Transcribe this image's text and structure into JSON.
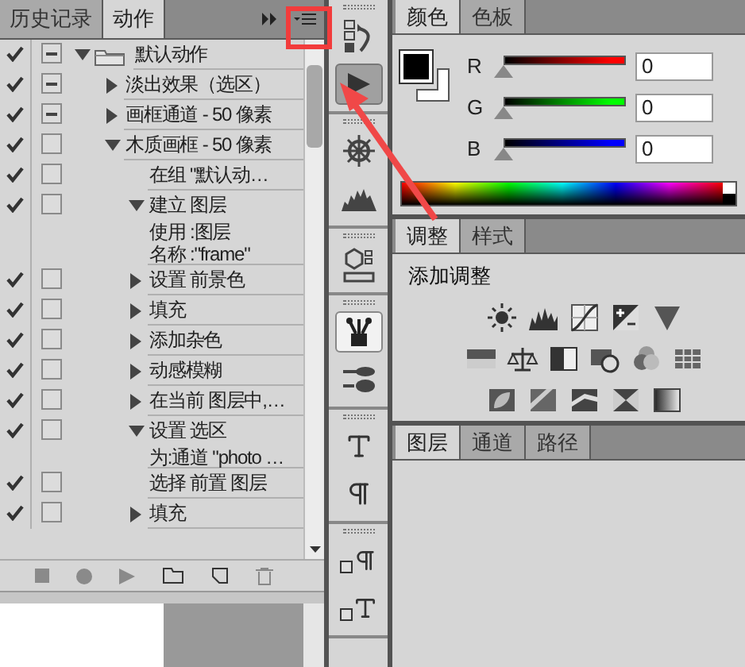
{
  "actions_panel": {
    "tabs": [
      {
        "label": "历史记录",
        "selected": false
      },
      {
        "label": "动作",
        "selected": true
      }
    ],
    "actions": [
      {
        "label": "默认动作",
        "kind": "set",
        "checked": true,
        "dialog": true,
        "expanded": true,
        "children": [
          {
            "label": "淡出效果（选区）",
            "kind": "item",
            "checked": true,
            "dialog": true,
            "expanded": false
          },
          {
            "label": "画框通道 - 50 像素",
            "kind": "item",
            "checked": true,
            "dialog": true,
            "expanded": false
          },
          {
            "label": "木质画框 - 50 像素",
            "kind": "item",
            "checked": true,
            "dialog": false,
            "expanded": true,
            "children": [
              {
                "label": "在组 \"默认动…",
                "kind": "step",
                "checked": true,
                "dialog": false
              },
              {
                "label": "建立 图层",
                "kind": "item",
                "checked": true,
                "dialog": false,
                "expanded": true,
                "details": [
                  "使用 :图层",
                  "名称 :\"frame\""
                ]
              },
              {
                "label": "设置 前景色",
                "kind": "item",
                "checked": true,
                "dialog": false,
                "expanded": false
              },
              {
                "label": "填充",
                "kind": "item",
                "checked": true,
                "dialog": false,
                "expanded": false
              },
              {
                "label": "添加杂色",
                "kind": "item",
                "checked": true,
                "dialog": false,
                "expanded": false
              },
              {
                "label": "动感模糊",
                "kind": "item",
                "checked": true,
                "dialog": false,
                "expanded": false
              },
              {
                "label": "在当前 图层中,…",
                "kind": "item",
                "checked": true,
                "dialog": false,
                "expanded": false
              },
              {
                "label": "设置 选区",
                "kind": "item",
                "checked": true,
                "dialog": false,
                "expanded": true,
                "details": [
                  "为:通道 \"photo …"
                ]
              },
              {
                "label": "选择 前置 图层",
                "kind": "step",
                "checked": true,
                "dialog": false
              },
              {
                "label": "填充",
                "kind": "item",
                "checked": true,
                "dialog": false,
                "expanded": false
              }
            ]
          }
        ]
      }
    ]
  },
  "dock": {
    "groups": [
      [
        {
          "kind": "history",
          "selected": false
        },
        {
          "kind": "actions",
          "selected": true
        }
      ],
      [
        {
          "kind": "navigator",
          "selected": false
        },
        {
          "kind": "histogram",
          "selected": false
        }
      ],
      [
        {
          "kind": "cube",
          "selected": false
        }
      ],
      [
        {
          "kind": "brush",
          "selected": true
        },
        {
          "kind": "presets",
          "selected": false
        }
      ],
      [
        {
          "kind": "character",
          "selected": false
        },
        {
          "kind": "paragraph",
          "selected": false
        }
      ],
      [
        {
          "kind": "parastyles",
          "selected": false
        },
        {
          "kind": "charstyles",
          "selected": false
        }
      ]
    ]
  },
  "color_panel": {
    "tabs": [
      {
        "label": "颜色",
        "selected": true
      },
      {
        "label": "色板",
        "selected": false
      }
    ],
    "swatches": [
      {
        "kind": "foreground",
        "color": "#000000"
      },
      {
        "kind": "background",
        "color": "#ffffff"
      }
    ],
    "channels": [
      {
        "label": "R",
        "color": "#ff0000",
        "level": 0,
        "value": "0"
      },
      {
        "label": "G",
        "color": "#00ff00",
        "level": 0,
        "value": "0"
      },
      {
        "label": "B",
        "color": "#0000ff",
        "level": 0,
        "value": "0"
      }
    ]
  },
  "adjustments_panel": {
    "tabs": [
      {
        "label": "调整",
        "selected": true
      },
      {
        "label": "样式",
        "selected": false
      }
    ],
    "heading": "添加调整"
  },
  "layers_panel": {
    "tabs": [
      {
        "label": "图层",
        "selected": true
      },
      {
        "label": "通道",
        "selected": false
      },
      {
        "label": "路径",
        "selected": false
      }
    ]
  }
}
